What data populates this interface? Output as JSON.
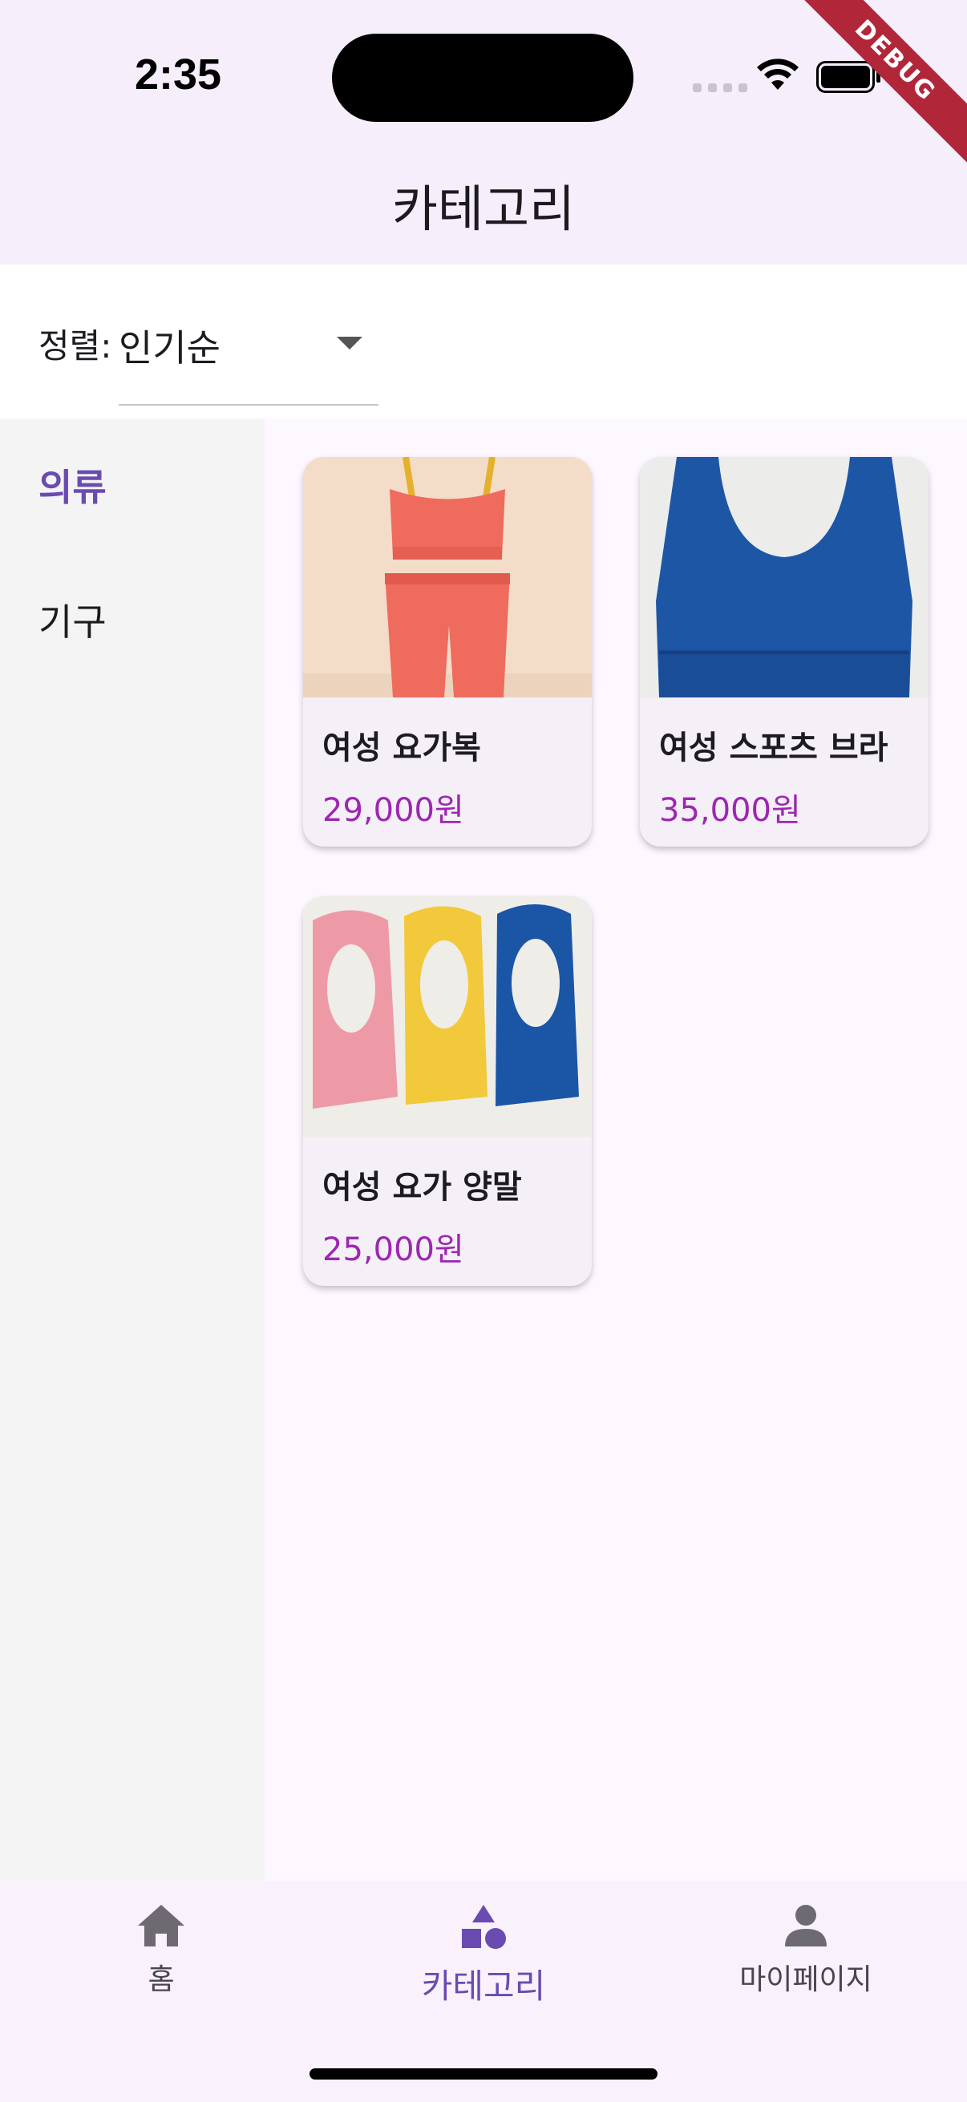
{
  "status_bar": {
    "time": "2:35"
  },
  "debug_banner": "DEBUG",
  "app_bar": {
    "title": "카테고리"
  },
  "sort": {
    "label": "정렬:",
    "value": "인기순"
  },
  "sidebar": {
    "items": [
      {
        "label": "의류",
        "active": true
      },
      {
        "label": "기구",
        "active": false
      }
    ]
  },
  "products": [
    {
      "name": "여성 요가복",
      "price": "29,000원",
      "image": "yoga-wear-image"
    },
    {
      "name": "여성 스포츠 브라",
      "price": "35,000원",
      "image": "sports-bra-image"
    },
    {
      "name": "여성 요가 양말",
      "price": "25,000원",
      "image": "yoga-socks-image"
    }
  ],
  "bottom_nav": {
    "items": [
      {
        "label": "홈",
        "icon": "home-icon",
        "active": false
      },
      {
        "label": "카테고리",
        "icon": "category-icon",
        "active": true
      },
      {
        "label": "마이페이지",
        "icon": "person-icon",
        "active": false
      }
    ]
  },
  "colors": {
    "accent": "#6a4bb1",
    "price": "#9c27b0",
    "app_bar_bg": "#f6eefa",
    "sidebar_bg": "#f4f4f4"
  }
}
